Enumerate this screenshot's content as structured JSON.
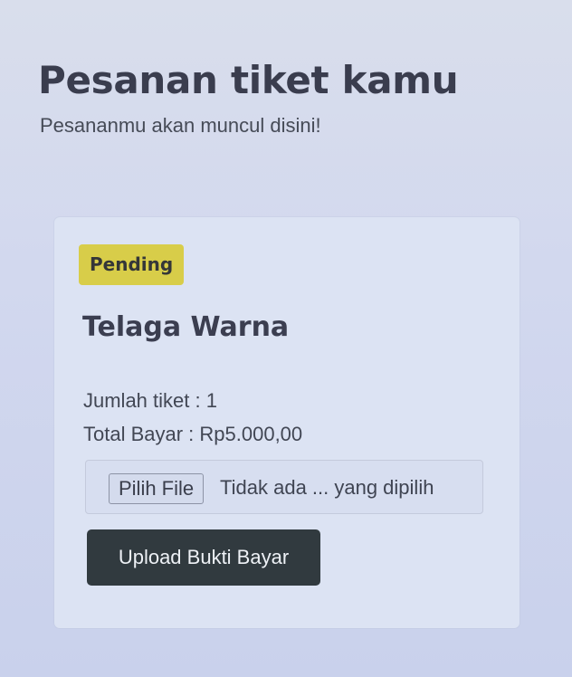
{
  "header": {
    "title": "Pesanan tiket kamu",
    "subtitle": "Pesananmu akan muncul disini!"
  },
  "order": {
    "status": "Pending",
    "status_color": "#d8cd49",
    "destination": "Telaga Warna",
    "ticket_count": "Jumlah tiket : 1",
    "total_payment": "Total Bayar : Rp5.000,00",
    "file_input": {
      "button_label": "Pilih File",
      "status_text": "Tidak ada ... yang dipilih"
    },
    "upload_button_label": "Upload Bukti Bayar",
    "upload_button_color": "#313a3f"
  }
}
